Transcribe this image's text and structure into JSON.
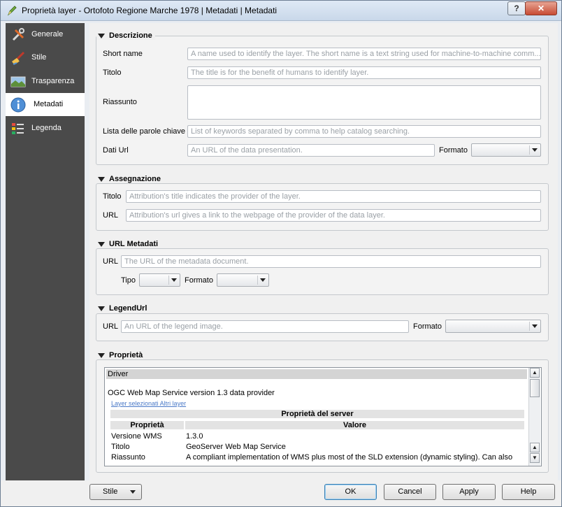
{
  "window": {
    "title": "Proprietà layer - Ortofoto Regione Marche 1978 | Metadati | Metadati",
    "help_label": "?",
    "close_label": "✕"
  },
  "sidebar": {
    "items": [
      {
        "label": "Generale",
        "icon": "tools-icon"
      },
      {
        "label": "Stile",
        "icon": "paintbrush-icon"
      },
      {
        "label": "Trasparenza",
        "icon": "transparency-icon"
      },
      {
        "label": "Metadati",
        "icon": "info-icon",
        "active": true
      },
      {
        "label": "Legenda",
        "icon": "legend-icon"
      }
    ]
  },
  "descrizione": {
    "title": "Descrizione",
    "short_name_label": "Short name",
    "short_name_placeholder": "A name used to identify the layer. The short name is a text string used for machine-to-machine comm...",
    "titolo_label": "Titolo",
    "titolo_placeholder": "The title is for the benefit of humans to identify layer.",
    "riassunto_label": "Riassunto",
    "keywords_label": "Lista delle parole chiave",
    "keywords_placeholder": "List of keywords separated by comma to help catalog searching.",
    "dati_url_label": "Dati Url",
    "dati_url_placeholder": "An URL of the data presentation.",
    "formato_label": "Formato"
  },
  "assegnazione": {
    "title": "Assegnazione",
    "titolo_label": "Titolo",
    "titolo_placeholder": "Attribution's title indicates the provider of the layer.",
    "url_label": "URL",
    "url_placeholder": "Attribution's url gives a link to the webpage of the provider of the data layer."
  },
  "url_metadati": {
    "title": "URL Metadati",
    "url_label": "URL",
    "url_placeholder": "The URL of the metadata document.",
    "tipo_label": "Tipo",
    "formato_label": "Formato"
  },
  "legend_url": {
    "title": "LegendUrl",
    "url_label": "URL",
    "url_placeholder": "An URL of the legend image.",
    "formato_label": "Formato"
  },
  "proprieta": {
    "title": "Proprietà",
    "driver_label": "Driver",
    "provider_text": "OGC Web Map Service version 1.3 data provider",
    "link_selected": "Layer selezionati",
    "link_other": "Altri layer",
    "server_header": "Proprietà del server",
    "col_property": "Proprietà",
    "col_value": "Valore",
    "rows": [
      {
        "key": "Versione WMS",
        "value": "1.3.0"
      },
      {
        "key": "Titolo",
        "value": "GeoServer Web Map Service"
      },
      {
        "key": "Riassunto",
        "value": "A compliant implementation of WMS plus most of the SLD extension (dynamic styling). Can also"
      }
    ]
  },
  "footer": {
    "stile_label": "Stile",
    "ok_label": "OK",
    "cancel_label": "Cancel",
    "apply_label": "Apply",
    "help_label": "Help"
  }
}
